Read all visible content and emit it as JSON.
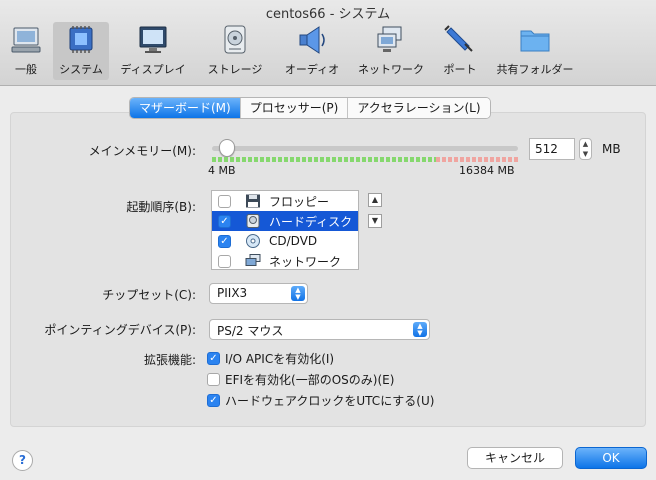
{
  "window": {
    "title": "centos66 - システム"
  },
  "toolbar": {
    "items": [
      {
        "label": "一般",
        "icon": "monitor-icon"
      },
      {
        "label": "システム",
        "icon": "chip-icon"
      },
      {
        "label": "ディスプレイ",
        "icon": "display-icon"
      },
      {
        "label": "ストレージ",
        "icon": "disk-icon"
      },
      {
        "label": "オーディオ",
        "icon": "speaker-icon"
      },
      {
        "label": "ネットワーク",
        "icon": "network-icon"
      },
      {
        "label": "ポート",
        "icon": "plug-icon"
      },
      {
        "label": "共有フォルダー",
        "icon": "folder-icon"
      }
    ],
    "selected": "システム"
  },
  "tabs": [
    "マザーボード(M)",
    "プロセッサー(P)",
    "アクセラレーション(L)"
  ],
  "motherboard": {
    "memory": {
      "label": "メインメモリー(M):",
      "value": "512",
      "unit": "MB",
      "min_label": "4 MB",
      "max_label": "16384 MB",
      "value_mb": 512,
      "min_mb": 4,
      "max_mb": 16384
    },
    "boot_order": {
      "label": "起動順序(B):",
      "items": [
        {
          "label": "フロッピー",
          "checked": false,
          "selected": false,
          "icon": "floppy-icon"
        },
        {
          "label": "ハードディスク",
          "checked": true,
          "selected": true,
          "icon": "harddisk-icon"
        },
        {
          "label": "CD/DVD",
          "checked": true,
          "selected": false,
          "icon": "cd-icon"
        },
        {
          "label": "ネットワーク",
          "checked": false,
          "selected": false,
          "icon": "network-icon"
        }
      ]
    },
    "chipset": {
      "label": "チップセット(C):",
      "value": "PIIX3"
    },
    "pointing": {
      "label": "ポインティングデバイス(P):",
      "value": "PS/2 マウス"
    },
    "extended": {
      "label": "拡張機能:",
      "options": [
        {
          "label": "I/O APICを有効化(I)",
          "checked": true
        },
        {
          "label": "EFIを有効化(一部のOSのみ)(E)",
          "checked": false
        },
        {
          "label": "ハードウェアクロックをUTCにする(U)",
          "checked": true
        }
      ]
    }
  },
  "footer": {
    "help": "?",
    "cancel": "キャンセル",
    "ok": "OK"
  },
  "colors": {
    "accent": "#0d74e8",
    "selection": "#1558d6"
  }
}
